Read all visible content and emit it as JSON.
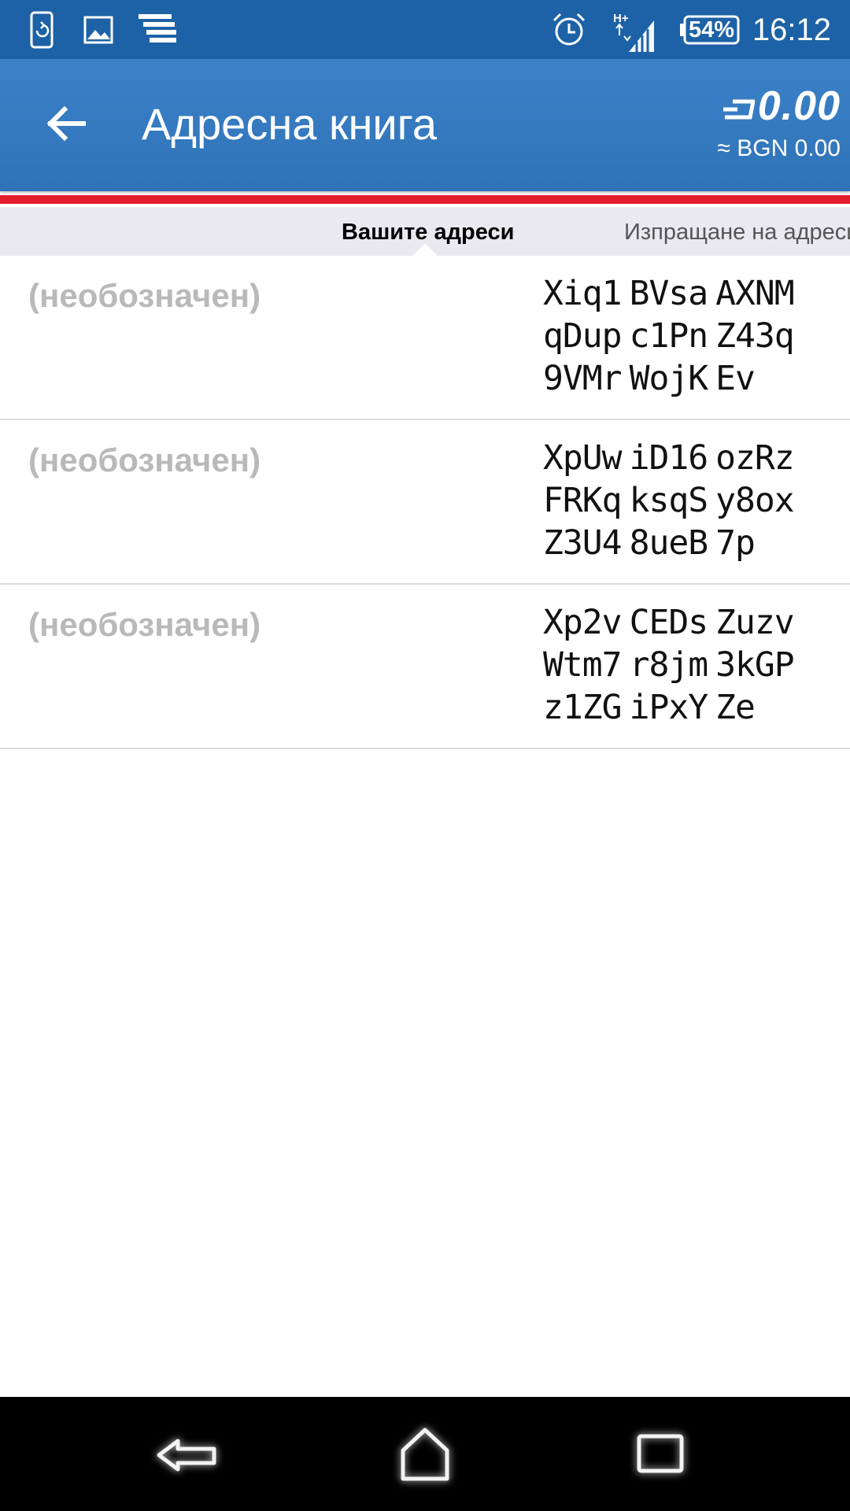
{
  "status_bar": {
    "time": "16:12",
    "battery": "54%",
    "network": "H+",
    "icons": [
      "screen-rotation-icon",
      "image-icon",
      "stack-icon",
      "alarm-icon",
      "signal-icon",
      "battery-icon"
    ]
  },
  "app_bar": {
    "title": "Адресна книга",
    "balance_amount": "0.00",
    "balance_fiat": "≈ BGN 0.00",
    "back_icon": "arrow-left-icon",
    "currency_icon": "dash-icon"
  },
  "tabs": [
    {
      "label": "Вашите адреси",
      "active": true
    },
    {
      "label": "Изпращане на адреси",
      "active": false
    }
  ],
  "addresses": [
    {
      "label": "(необозначен)",
      "lines": [
        [
          "Xiq1",
          "BVsa",
          "AXNM"
        ],
        [
          "qDup",
          "c1Pn",
          "Z43q"
        ],
        [
          "9VMr",
          "WojK",
          "Ev"
        ]
      ]
    },
    {
      "label": "(необозначен)",
      "lines": [
        [
          "XpUw",
          "iD16",
          "ozRz"
        ],
        [
          "FRKq",
          "ksqS",
          "y8ox"
        ],
        [
          "Z3U4",
          "8ueB",
          "7p"
        ]
      ]
    },
    {
      "label": "(необозначен)",
      "lines": [
        [
          "Xp2v",
          "CEDs",
          "Zuzv"
        ],
        [
          "Wtm7",
          "r8jm",
          "3kGP"
        ],
        [
          "z1ZG",
          "iPxY",
          "Ze"
        ]
      ]
    }
  ],
  "colors": {
    "status_bar": "#1d62a6",
    "app_bar": "#3478be",
    "accent_stripe": "#e31e2a",
    "tab_strip": "#e9e9ef",
    "label_gray": "#b9b9b9"
  },
  "nav_bar": {
    "icons": [
      "back-icon",
      "home-icon",
      "recent-apps-icon"
    ]
  }
}
